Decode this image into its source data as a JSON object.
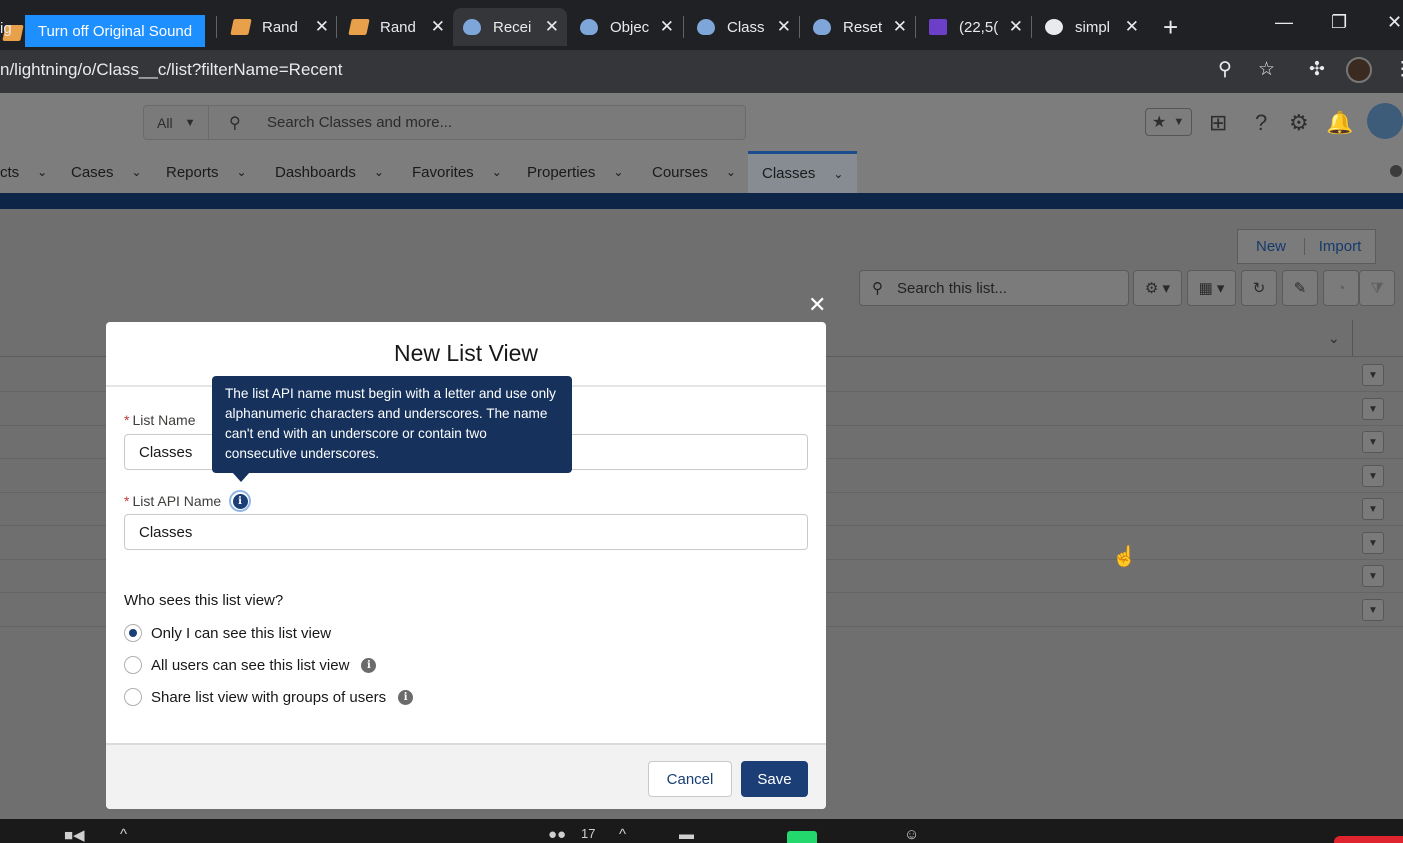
{
  "browser": {
    "zoom_banner": "Turn off Original Sound",
    "tabs": [
      {
        "label": "Rand"
      },
      {
        "label": "Rand"
      },
      {
        "label": "Recei"
      },
      {
        "label": "Objec"
      },
      {
        "label": "Class"
      },
      {
        "label": "Reset"
      },
      {
        "label": "(22,5("
      },
      {
        "label": "simpl"
      }
    ],
    "first_tab_fragment": "ig",
    "new_tab": "+",
    "url": "n/lightning/o/Class__c/list?filterName=Recent"
  },
  "sf_header": {
    "search_scope": "All",
    "search_placeholder": "Search Classes and more..."
  },
  "nav": {
    "items": [
      {
        "label": "cts"
      },
      {
        "label": "Cases"
      },
      {
        "label": "Reports"
      },
      {
        "label": "Dashboards"
      },
      {
        "label": "Favorites"
      },
      {
        "label": "Properties"
      },
      {
        "label": "Courses"
      },
      {
        "label": "Classes"
      }
    ]
  },
  "list": {
    "new_label": "New",
    "import_label": "Import",
    "search_placeholder": "Search this list..."
  },
  "modal": {
    "title": "New List View",
    "list_name_label": "List Name",
    "list_name_value": "Classes",
    "api_name_label": "List API Name",
    "api_name_value": "Classes",
    "tooltip": "The list API name must begin with a letter and use only alphanumeric characters and underscores. The name can't end with an underscore or contain two consecutive underscores.",
    "visibility_question": "Who sees this list view?",
    "options": [
      {
        "label": "Only I can see this list view",
        "selected": true
      },
      {
        "label": "All users can see this list view",
        "selected": false
      },
      {
        "label": "Share list view with groups of users",
        "selected": false
      }
    ],
    "cancel_label": "Cancel",
    "save_label": "Save"
  },
  "zoom_bar": {
    "participants": "17"
  },
  "colors": {
    "brand_blue": "#1b3e76",
    "tooltip_bg": "#16325c",
    "zoom_blue": "#1e8fff",
    "required_red": "#c23934"
  }
}
